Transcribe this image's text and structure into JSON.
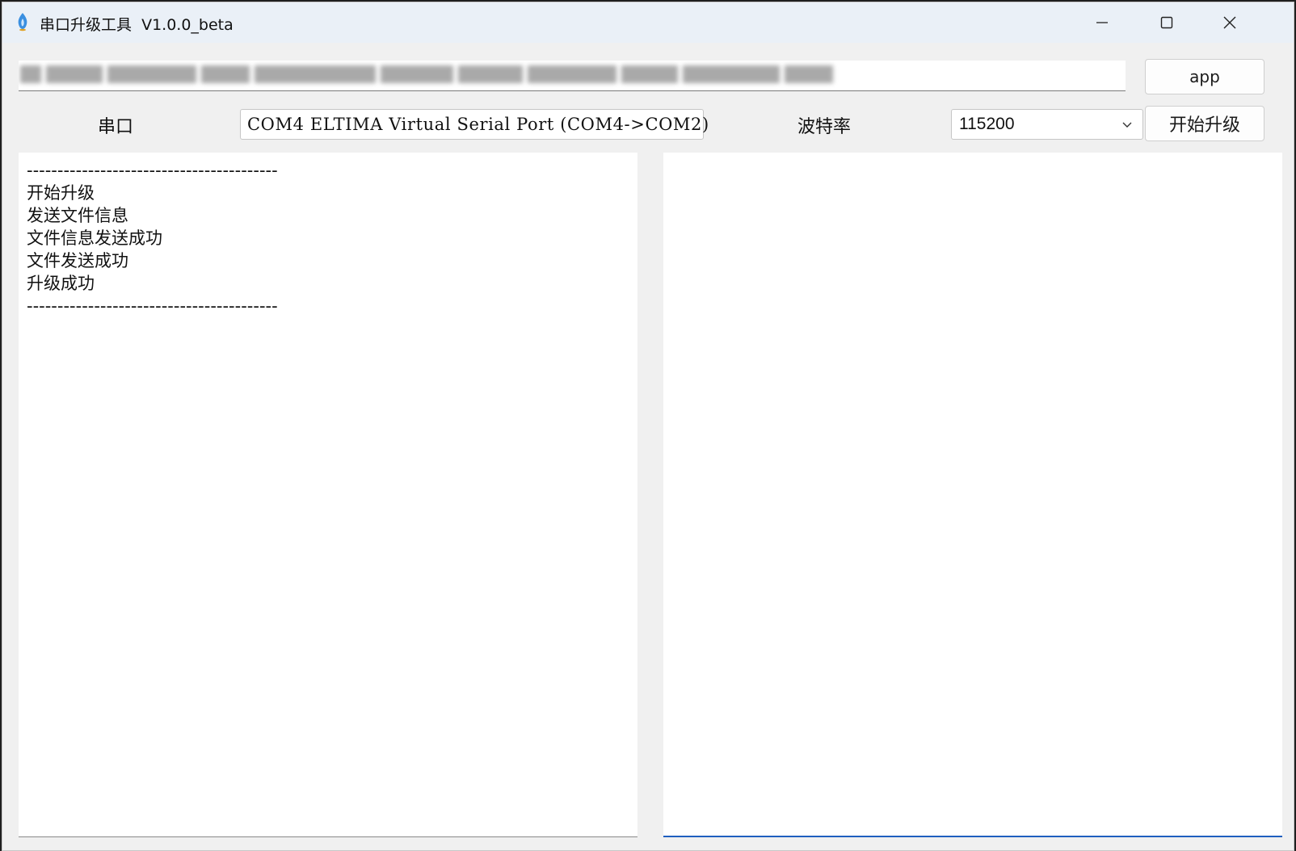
{
  "window": {
    "title": "串口升级工具  V1.0.0_beta"
  },
  "icons": {
    "app": "app-flame-icon",
    "minimize": "minimize-icon",
    "maximize": "maximize-icon",
    "close": "close-icon",
    "dropdown": "chevron-down-icon"
  },
  "file_path": {
    "value": ""
  },
  "buttons": {
    "app_label": "app",
    "start_label": "开始升级"
  },
  "port": {
    "label": "串口",
    "selected": "COM4 ELTIMA Virtual Serial Port (COM4->COM2)"
  },
  "baud": {
    "label": "波特率",
    "selected": "115200"
  },
  "log": {
    "lines": [
      "-----------------------------------------",
      "开始升级",
      "发送文件信息",
      "文件信息发送成功",
      "文件发送成功",
      "升级成功",
      "-----------------------------------------"
    ]
  },
  "colors": {
    "window_bg": "#f0f0f0",
    "titlebar_bg": "#eaf0f7",
    "focus_accent": "#1f5fbf"
  }
}
